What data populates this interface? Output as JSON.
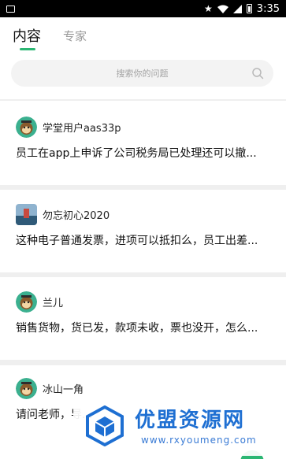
{
  "status_bar": {
    "time": "3:35"
  },
  "tabs": [
    {
      "label": "内容",
      "active": true
    },
    {
      "label": "专家",
      "active": false
    }
  ],
  "search": {
    "placeholder": "搜索你的问题"
  },
  "questions": [
    {
      "user": "学堂用户aas33p",
      "avatar": "monkey-avatar",
      "text": "员工在app上申诉了公司税务局已处理还可以撤..."
    },
    {
      "user": "勿忘初心2020",
      "avatar": "photo-avatar",
      "text": "这种电子普通发票，进项可以抵扣么，员工出差..."
    },
    {
      "user": "兰儿",
      "avatar": "monkey-avatar",
      "text": "销售货物，货已发，款项未收，票也没开，怎么..."
    },
    {
      "user": "冰山一角",
      "avatar": "monkey-avatar",
      "text": "请问老师，导..."
    }
  ],
  "watermark": {
    "title": "优盟资源网",
    "url": "www.rxyoumeng.com"
  },
  "colors": {
    "accent": "#2bb673",
    "watermark_blue": "#1e6fd2"
  }
}
